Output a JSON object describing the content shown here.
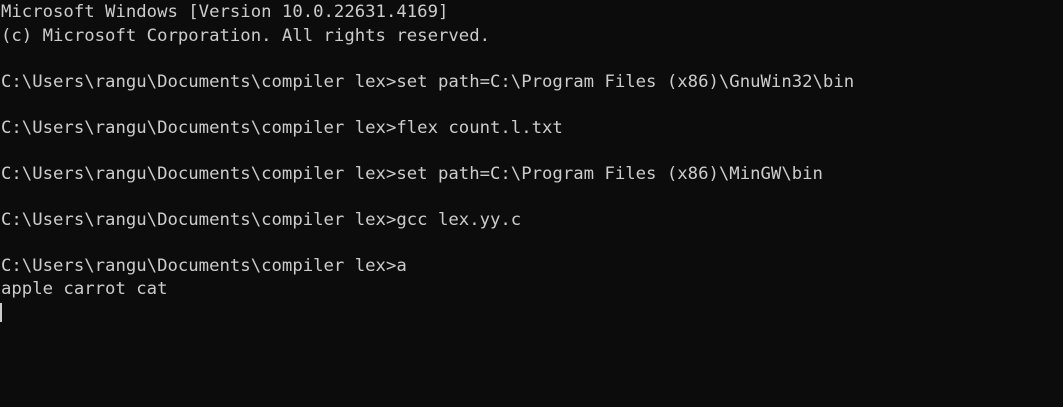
{
  "terminal": {
    "background": "#0c0c0c",
    "foreground": "#cccccc",
    "lines": [
      "Microsoft Windows [Version 10.0.22631.4169]",
      "(c) Microsoft Corporation. All rights reserved.",
      "C:\\Users\\rangu\\Documents\\compiler lex>set path=C:\\Program Files (x86)\\GnuWin32\\bin",
      "C:\\Users\\rangu\\Documents\\compiler lex>flex count.l.txt",
      "C:\\Users\\rangu\\Documents\\compiler lex>set path=C:\\Program Files (x86)\\MinGW\\bin",
      "C:\\Users\\rangu\\Documents\\compiler lex>gcc lex.yy.c",
      "C:\\Users\\rangu\\Documents\\compiler lex>a",
      "apple carrot cat"
    ]
  }
}
